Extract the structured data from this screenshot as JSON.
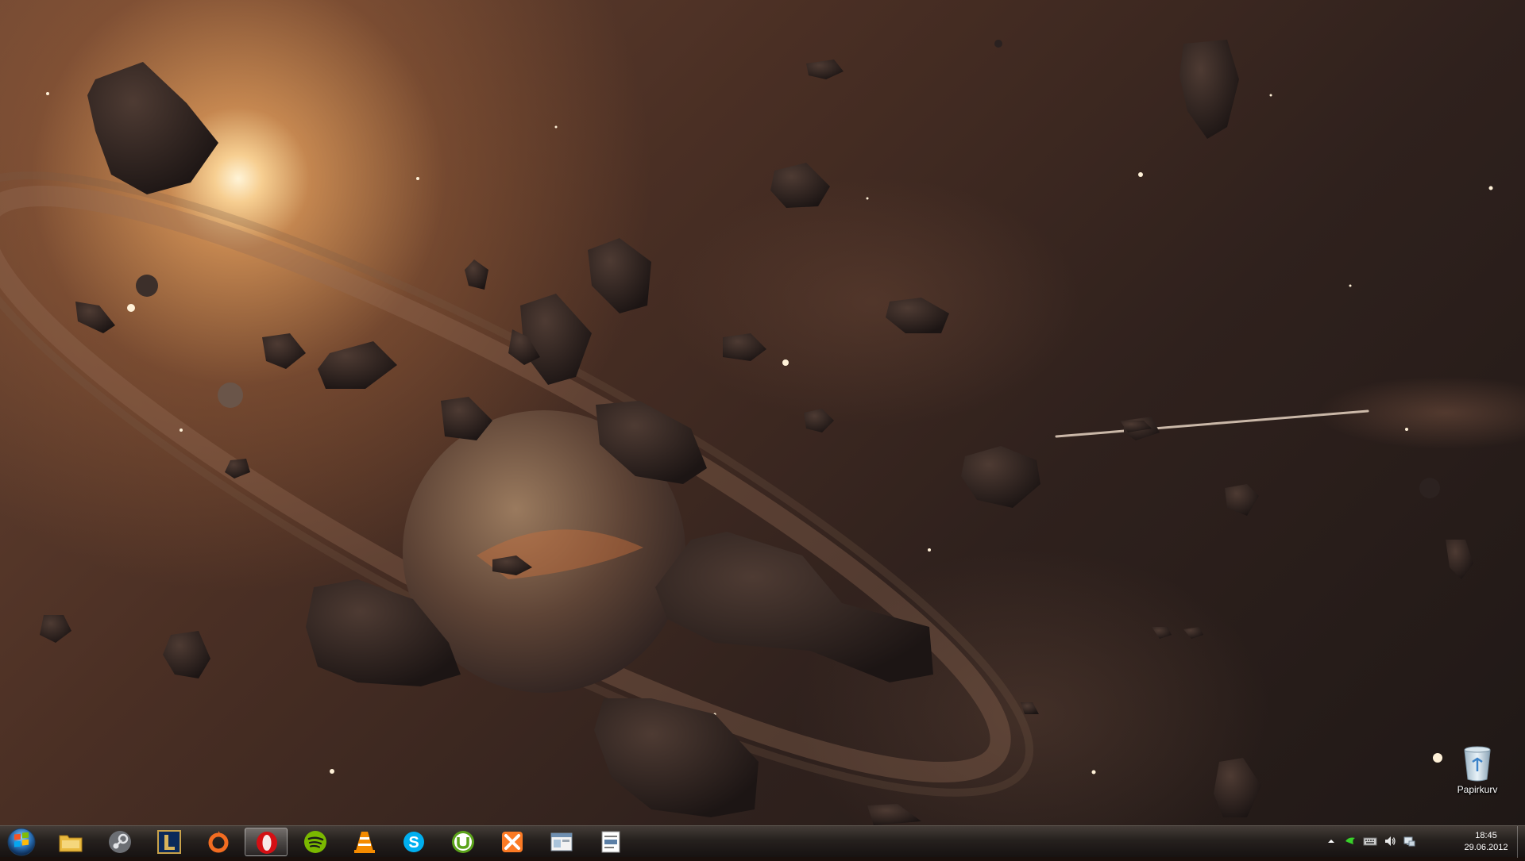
{
  "desktop": {
    "wallpaper": "space-asteroids-wallpaper",
    "icons": [
      {
        "label": "Papirkurv",
        "icon": "recycle-bin-icon"
      }
    ]
  },
  "taskbar": {
    "start": {
      "icon": "windows-start-orb-icon"
    },
    "pinned": [
      {
        "name": "explorer",
        "icon": "folder-icon"
      },
      {
        "name": "steam",
        "icon": "steam-icon"
      },
      {
        "name": "league-of-legends",
        "icon": "league-of-legends-icon"
      },
      {
        "name": "origin",
        "icon": "origin-icon"
      },
      {
        "name": "opera",
        "icon": "opera-icon",
        "active": true
      },
      {
        "name": "spotify",
        "icon": "spotify-icon"
      },
      {
        "name": "vlc",
        "icon": "vlc-icon"
      },
      {
        "name": "skype",
        "icon": "skype-icon"
      },
      {
        "name": "utorrent",
        "icon": "utorrent-icon"
      },
      {
        "name": "xampp",
        "icon": "xampp-icon"
      },
      {
        "name": "window-app",
        "icon": "window-icon"
      },
      {
        "name": "document-app",
        "icon": "document-icon"
      }
    ],
    "tray": {
      "icons": [
        "show-hidden-icons-arrow",
        "razer-icon",
        "keyboard-icon",
        "volume-icon",
        "network-icon"
      ],
      "time": "18:45",
      "date": "29.06.2012"
    }
  },
  "colors": {
    "taskbar": "#262120",
    "text": "#ffffff",
    "sun": "#fff4d7"
  }
}
